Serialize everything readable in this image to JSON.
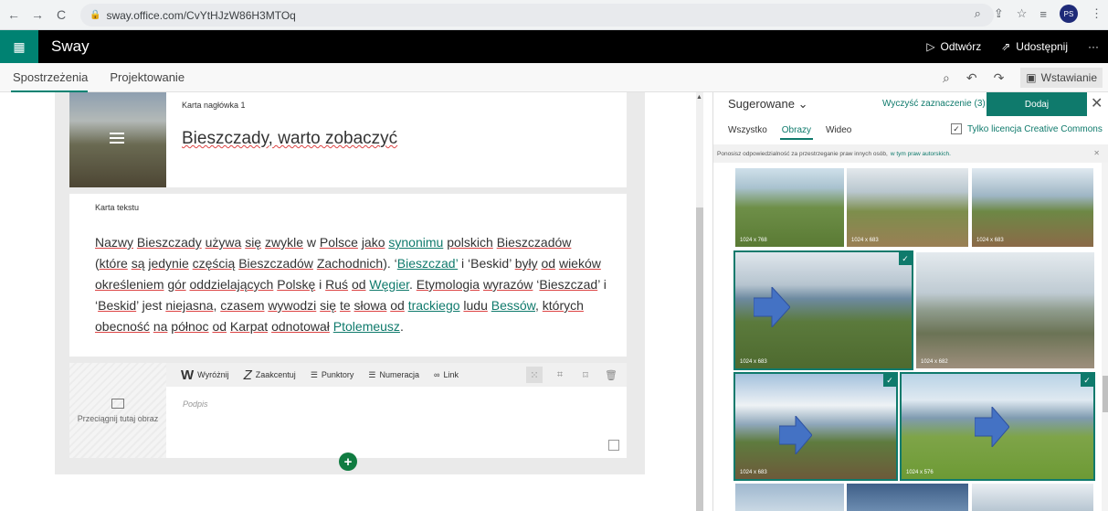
{
  "browser": {
    "url": "sway.office.com/CvYtHJzW86H3MTOq",
    "profile_initials": "PS"
  },
  "header": {
    "app_name": "Sway",
    "play_label": "Odtwórz",
    "share_label": "Udostępnij",
    "more_label": "···"
  },
  "tabs": {
    "storyline": "Spostrzeżenia",
    "design": "Projektowanie",
    "insert_label": "Wstawianie"
  },
  "cards": {
    "heading_card_label": "Karta nagłówka 1",
    "heading_title": "Bieszczady, warto zobaczyć",
    "text_card_label": "Karta tekstu",
    "image_drop_label": "Przeciągnij tutaj obraz",
    "caption_placeholder": "Podpis"
  },
  "toolbar": {
    "emphasize": "Wyróżnij",
    "accent": "Zaakcentuj",
    "bullets": "Punktory",
    "numbering": "Numeracja",
    "link": "Link"
  },
  "panel": {
    "suggested": "Sugerowane",
    "clear_selection": "Wyczyść zaznaczenie (3)",
    "add": "Dodaj",
    "filter_all": "Wszystko",
    "filter_images": "Obrazy",
    "filter_video": "Wideo",
    "creative_commons": "Tylko licencja Creative Commons",
    "notice_text": "Ponosisz odpowiedzialność za przestrzeganie praw innych osób,",
    "notice_link": "w tym praw autorskich."
  },
  "images": [
    {
      "size": "1024 x 768"
    },
    {
      "size": "1024 x 683"
    },
    {
      "size": "1024 x 683"
    },
    {
      "size": "1024 x 683"
    },
    {
      "size": "1024 x 682"
    },
    {
      "size": "1024 x 683"
    },
    {
      "size": "1024 x 576"
    }
  ],
  "colors": {
    "accent": "#0f7a6c",
    "app_bar": "#000000",
    "waffle": "#008272",
    "arrow": "#4472c4"
  }
}
